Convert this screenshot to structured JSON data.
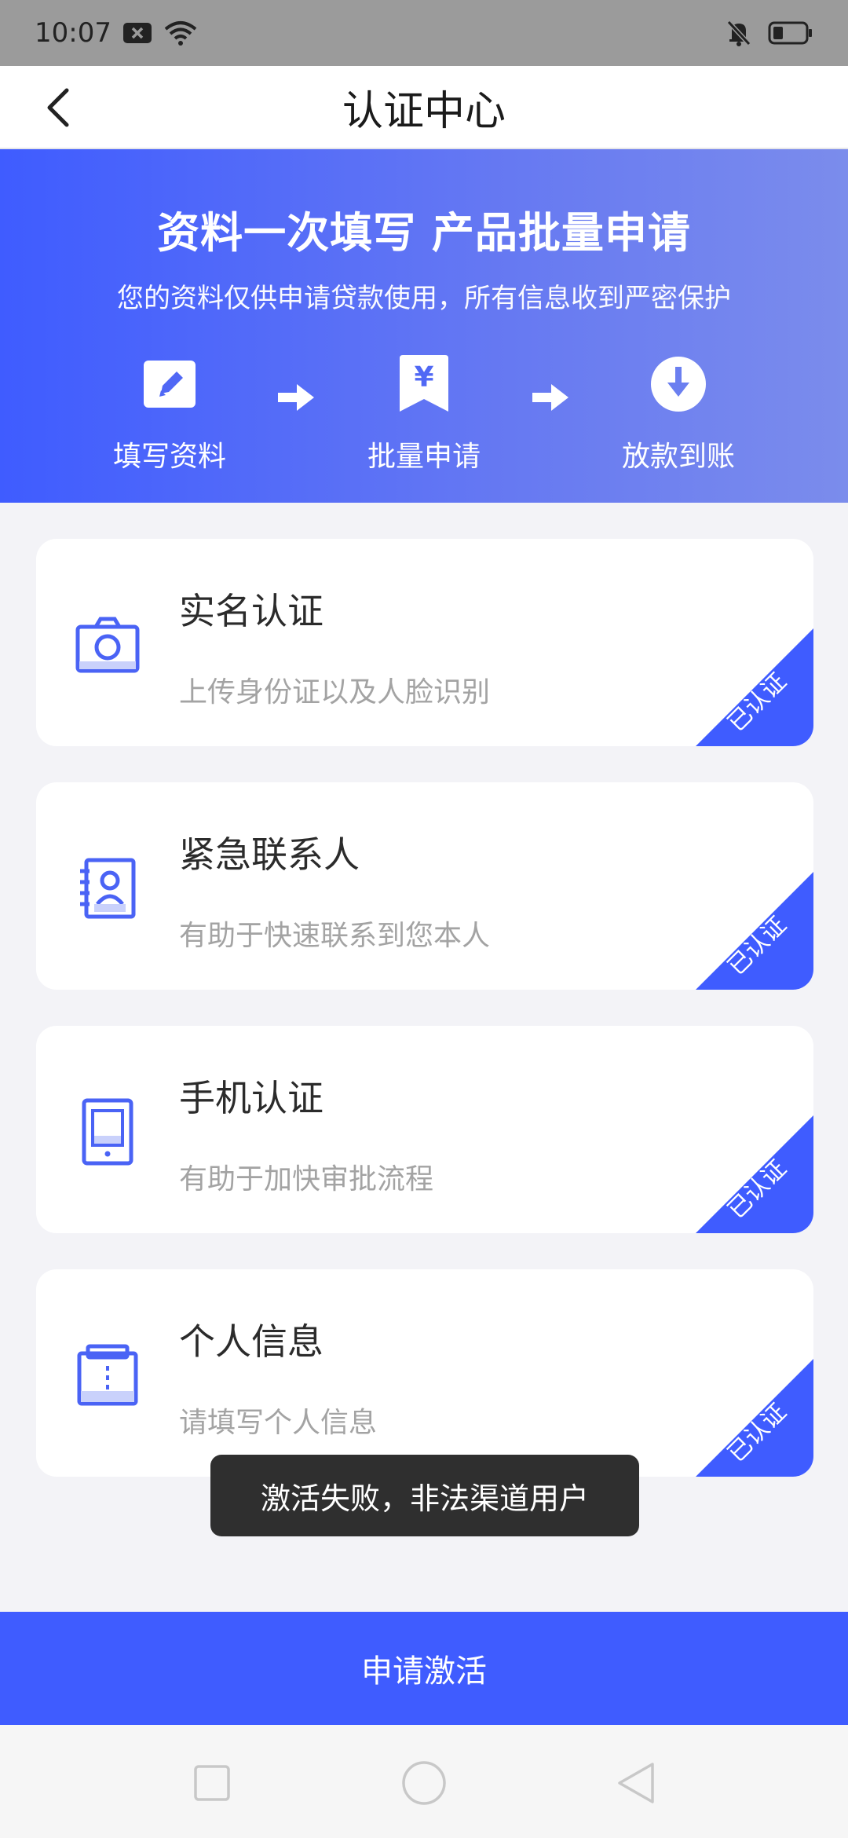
{
  "status_bar": {
    "time": "10:07"
  },
  "nav": {
    "title": "认证中心"
  },
  "banner": {
    "title": "资料一次填写  产品批量申请",
    "subtitle": "您的资料仅供申请贷款使用，所有信息收到严密保护",
    "steps": [
      {
        "label": "填写资料",
        "icon": "edit-icon"
      },
      {
        "label": "批量申请",
        "icon": "yen-bookmark-icon"
      },
      {
        "label": "放款到账",
        "icon": "download-icon"
      }
    ]
  },
  "cards": [
    {
      "title": "实名认证",
      "desc": "上传身份证以及人脸识别",
      "badge": "已认证",
      "icon": "camera-icon"
    },
    {
      "title": "紧急联系人",
      "desc": "有助于快速联系到您本人",
      "badge": "已认证",
      "icon": "contact-book-icon"
    },
    {
      "title": "手机认证",
      "desc": "有助于加快审批流程",
      "badge": "已认证",
      "icon": "phone-icon"
    },
    {
      "title": "个人信息",
      "desc": "请填写个人信息",
      "badge": "已认证",
      "icon": "id-card-icon"
    }
  ],
  "toast": {
    "text": "激活失败，非法渠道用户"
  },
  "apply_button": {
    "label": "申请激活"
  },
  "colors": {
    "accent": "#3f5cff",
    "toast_bg": "#2f2f2f"
  }
}
